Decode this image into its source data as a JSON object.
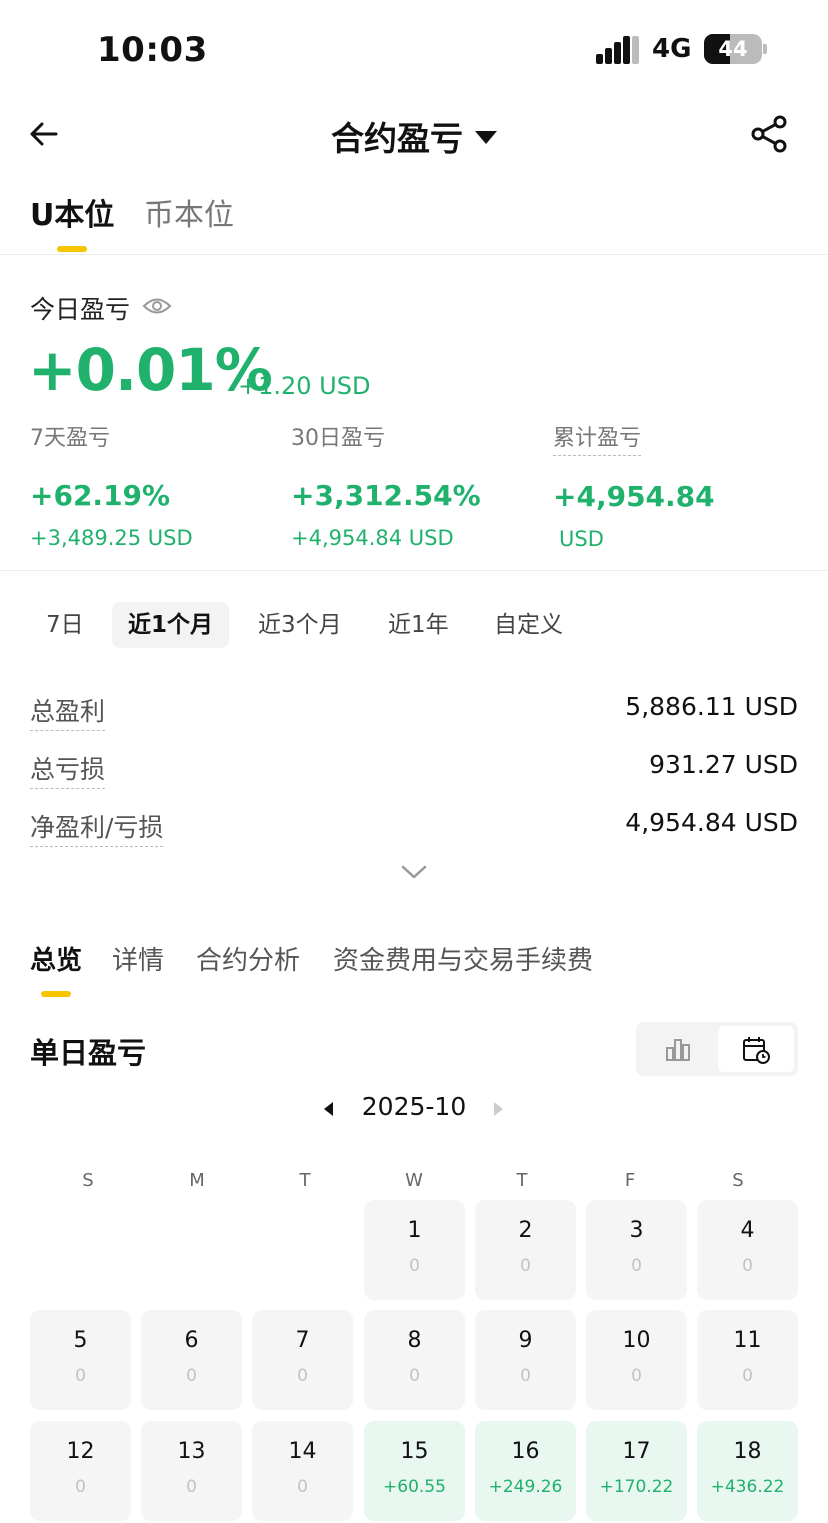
{
  "status": {
    "time": "10:03",
    "network": "4G",
    "battery": "44",
    "battery_level": 0.44
  },
  "header": {
    "title": "合约盈亏",
    "icons": {
      "back": "back-arrow-icon",
      "dropdown": "caret-down-icon",
      "share": "share-icon"
    }
  },
  "unit_tabs": [
    {
      "label": "U本位",
      "active": true
    },
    {
      "label": "币本位",
      "active": false
    }
  ],
  "today": {
    "label": "今日盈亏",
    "percent": "+0.01%",
    "usd": "+1.20 USD"
  },
  "stats": [
    {
      "label": "7天盈亏",
      "value": "+62.19%",
      "sub": "+3,489.25 USD"
    },
    {
      "label": "30日盈亏",
      "value": "+3,312.54%",
      "sub": "+4,954.84 USD"
    },
    {
      "label": "累计盈亏",
      "value": "+4,954.84",
      "sub": "USD"
    }
  ],
  "range_tabs": [
    {
      "label": "7日",
      "active": false
    },
    {
      "label": "近1个月",
      "active": true
    },
    {
      "label": "近3个月",
      "active": false
    },
    {
      "label": "近1年",
      "active": false
    },
    {
      "label": "自定义",
      "active": false
    }
  ],
  "summary": [
    {
      "label": "总盈利",
      "value": "5,886.11 USD"
    },
    {
      "label": "总亏损",
      "value": "931.27 USD"
    },
    {
      "label": "净盈利/亏损",
      "value": "4,954.84 USD"
    }
  ],
  "section_tabs": [
    {
      "label": "总览",
      "active": true
    },
    {
      "label": "详情",
      "active": false
    },
    {
      "label": "合约分析",
      "active": false
    },
    {
      "label": "资金费用与交易手续费",
      "active": false
    }
  ],
  "daily": {
    "title": "单日盈亏",
    "month": "2025-10",
    "view_icons": [
      "bar-chart-icon",
      "calendar-icon"
    ],
    "weekdays": [
      "S",
      "M",
      "T",
      "W",
      "T",
      "F",
      "S"
    ],
    "days": [
      {
        "day": "1",
        "pnl": "0"
      },
      {
        "day": "2",
        "pnl": "0"
      },
      {
        "day": "3",
        "pnl": "0"
      },
      {
        "day": "4",
        "pnl": "0"
      },
      {
        "day": "5",
        "pnl": "0"
      },
      {
        "day": "6",
        "pnl": "0"
      },
      {
        "day": "7",
        "pnl": "0"
      },
      {
        "day": "8",
        "pnl": "0"
      },
      {
        "day": "9",
        "pnl": "0"
      },
      {
        "day": "10",
        "pnl": "0"
      },
      {
        "day": "11",
        "pnl": "0"
      },
      {
        "day": "12",
        "pnl": "0"
      },
      {
        "day": "13",
        "pnl": "0"
      },
      {
        "day": "14",
        "pnl": "0"
      },
      {
        "day": "15",
        "pnl": "+60.55"
      },
      {
        "day": "16",
        "pnl": "+249.26"
      },
      {
        "day": "17",
        "pnl": "+170.22"
      },
      {
        "day": "18",
        "pnl": "+436.22"
      }
    ]
  },
  "colors": {
    "positive": "#20b26c",
    "accent": "#f7c600",
    "gain_cell": "#e8f7ef",
    "neutral_cell": "#f5f5f5"
  }
}
